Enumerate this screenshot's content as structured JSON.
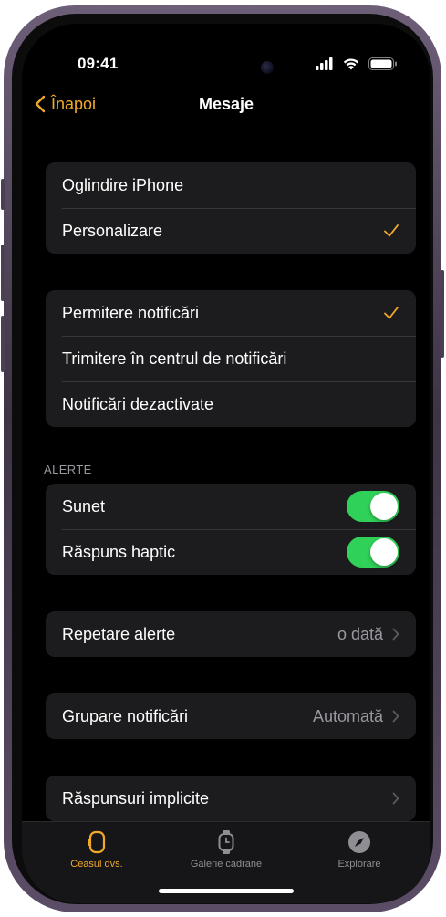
{
  "status_bar": {
    "time": "09:41"
  },
  "nav": {
    "back_label": "Înapoi",
    "title": "Mesaje"
  },
  "groups": {
    "mirror": {
      "items": [
        {
          "label": "Oglindire iPhone",
          "checked": false
        },
        {
          "label": "Personalizare",
          "checked": true
        }
      ]
    },
    "notifications": {
      "items": [
        {
          "label": "Permitere notificări",
          "checked": true
        },
        {
          "label": "Trimitere în centrul de notificări",
          "checked": false
        },
        {
          "label": "Notificări dezactivate",
          "checked": false
        }
      ]
    },
    "alerts": {
      "header": "ALERTE",
      "items": [
        {
          "label": "Sunet",
          "on": true
        },
        {
          "label": "Răspuns haptic",
          "on": true
        }
      ]
    },
    "repeat": {
      "label": "Repetare alerte",
      "value": "o dată"
    },
    "grouping": {
      "label": "Grupare notificări",
      "value": "Automată"
    },
    "replies": {
      "label": "Răspunsuri implicite"
    }
  },
  "tab_bar": {
    "tabs": [
      {
        "label": "Ceasul dvs.",
        "icon": "watch-icon",
        "active": true
      },
      {
        "label": "Galerie cadrane",
        "icon": "watch-face-icon",
        "active": false
      },
      {
        "label": "Explorare",
        "icon": "compass-icon",
        "active": false
      }
    ]
  },
  "colors": {
    "accent": "#f2a92b",
    "toggle_on": "#30d158",
    "group_background": "#1c1c1e",
    "secondary_text": "#98989f"
  }
}
